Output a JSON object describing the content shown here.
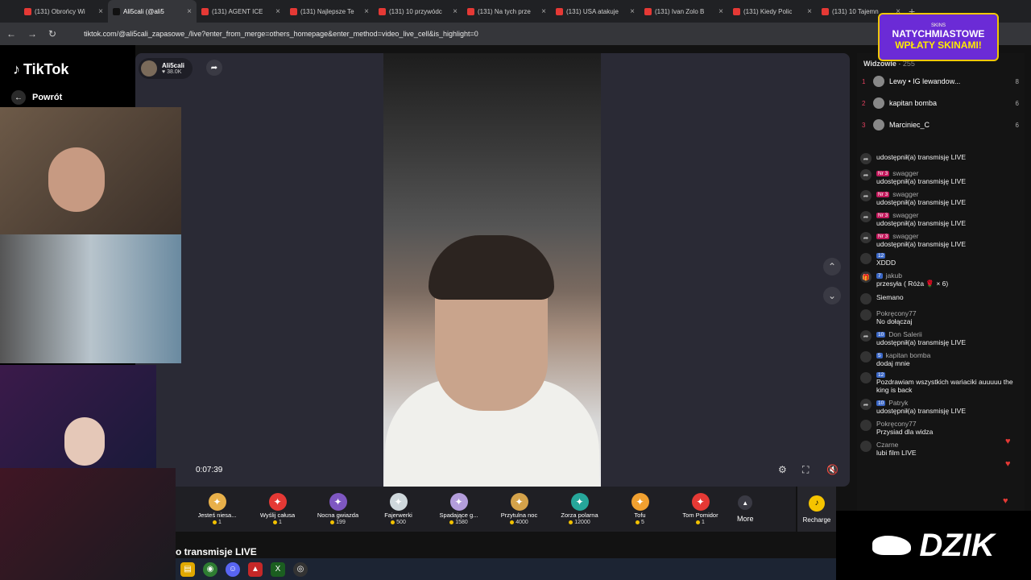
{
  "browser": {
    "tabs": [
      {
        "title": "(131) Obrońcy Wi"
      },
      {
        "title": "Ali5cali (@ali5"
      },
      {
        "title": "(131) AGENT ICE"
      },
      {
        "title": "(131) Najlepsze Te"
      },
      {
        "title": "(131) 10 przywódc"
      },
      {
        "title": "(131) Na tych prze"
      },
      {
        "title": "(131) USA atakuje"
      },
      {
        "title": "(131) Ivan Zolo B"
      },
      {
        "title": "(131) Kiedy Polic"
      },
      {
        "title": "(131) 10 Tajemn"
      }
    ],
    "url": "tiktok.com/@ali5cali_zapasowe_/live?enter_from_merge=others_homepage&enter_method=video_live_cell&is_highlight=0"
  },
  "sidebar": {
    "logo": "TikTok",
    "back_label": "Powrót"
  },
  "stream": {
    "streamer_name": "Ali5cali",
    "likes": "38.0K",
    "elapsed": "0:07:39",
    "bottom_title": "o transmisje LIVE"
  },
  "gifts": [
    {
      "name": "Jesteś niesa...",
      "price": "1",
      "icon": "hamster-icon",
      "color": "#e8b04a"
    },
    {
      "name": "Wyślij całusa",
      "price": "1",
      "icon": "kiss-icon",
      "color": "#e53935"
    },
    {
      "name": "Nocna gwiazda",
      "price": "199",
      "icon": "ghost-icon",
      "color": "#7e57c2"
    },
    {
      "name": "Fajerwerki",
      "price": "500",
      "icon": "firework-icon",
      "color": "#cfd8dc"
    },
    {
      "name": "Spadające g...",
      "price": "1580",
      "icon": "star-icon",
      "color": "#b39ddb"
    },
    {
      "name": "Przytulna noc",
      "price": "4000",
      "icon": "lamp-icon",
      "color": "#d4a24a"
    },
    {
      "name": "Zorza polarna",
      "price": "12000",
      "icon": "aurora-icon",
      "color": "#26a69a"
    },
    {
      "name": "Tofu",
      "price": "5",
      "icon": "tofu-icon",
      "color": "#f0a030"
    },
    {
      "name": "Tom Pomidor",
      "price": "1",
      "icon": "tomato-icon",
      "color": "#e53935"
    }
  ],
  "more_label": "More",
  "recharge_label": "Recharge",
  "viewers": {
    "title": "Widzowie",
    "count": "255",
    "top": [
      {
        "rank": "1",
        "name": "Lewy • IG lewandow...",
        "count": "8"
      },
      {
        "rank": "2",
        "name": "kapitan bomba",
        "count": "6"
      },
      {
        "rank": "3",
        "name": "Marciniec_C",
        "count": "6"
      }
    ]
  },
  "chat": [
    {
      "user": "",
      "badge": "",
      "text": "udostępnił(a) transmisję LIVE",
      "icon": "share"
    },
    {
      "user": "swagger",
      "badge": "Nr 3",
      "text": "udostępnił(a) transmisję LIVE",
      "icon": "share"
    },
    {
      "user": "swagger",
      "badge": "Nr 3",
      "text": "udostępnił(a) transmisję LIVE",
      "icon": "share"
    },
    {
      "user": "swagger",
      "badge": "Nr 3",
      "text": "udostępnił(a) transmisję LIVE",
      "icon": "share"
    },
    {
      "user": "swagger",
      "badge": "Nr 3",
      "text": "udostępnił(a) transmisję LIVE",
      "icon": "share"
    },
    {
      "user": "",
      "badge": "12",
      "text": "XDDD",
      "icon": "avatar"
    },
    {
      "user": "jakub",
      "badge": "7",
      "text": "przesyła ( Róża 🌹 × 6)",
      "icon": "gift"
    },
    {
      "user": "",
      "badge": "",
      "text": "Siemano",
      "icon": "avatar"
    },
    {
      "user": "Pokręcony77",
      "badge": "",
      "text": "No dołączaj",
      "icon": "avatar"
    },
    {
      "user": "Don Salerii",
      "badge": "10",
      "text": "udostępnił(a) transmisję LIVE",
      "icon": "share"
    },
    {
      "user": "kapitan bomba",
      "badge": "5",
      "text": "dodaj mnie",
      "icon": "avatar"
    },
    {
      "user": "",
      "badge": "12",
      "text": "Pozdrawiam wszystkich wariaciki auuuuu the king is back",
      "icon": "avatar"
    },
    {
      "user": "Patryk",
      "badge": "10",
      "text": "udostępnił(a) transmisję LIVE",
      "icon": "share"
    },
    {
      "user": "Pokręcony77",
      "badge": "",
      "text": "Przysiad dla widza",
      "icon": "avatar"
    },
    {
      "user": "Czarne",
      "badge": "",
      "text": "lubi film LIVE",
      "icon": "avatar"
    }
  ],
  "promo": {
    "brand": "SKINS",
    "line1": "NATYCHMIASTOWE",
    "line2": "WPŁATY SKINAMI!"
  },
  "overlay_logo": "DZIK"
}
